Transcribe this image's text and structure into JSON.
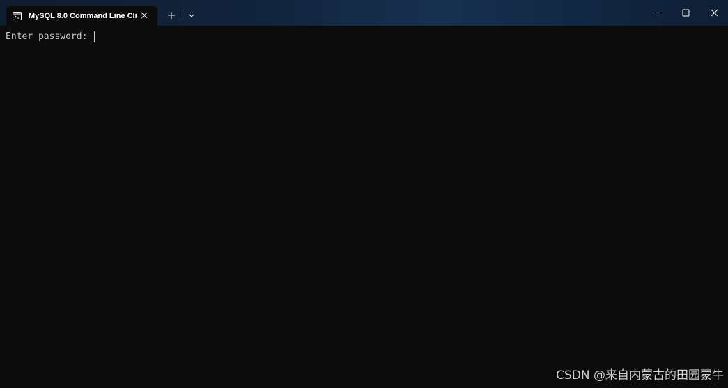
{
  "window": {
    "tab_title": "MySQL 8.0 Command Line Cli",
    "tab_icon": "terminal-icon",
    "new_tab_icon": "plus-icon",
    "dropdown_icon": "chevron-down-icon",
    "minimize_icon": "minimize-icon",
    "maximize_icon": "maximize-icon",
    "close_icon": "close-icon"
  },
  "console": {
    "prompt": "Enter password: "
  },
  "watermark": {
    "text": "CSDN @来自内蒙古的田园蒙牛"
  },
  "colors": {
    "console_bg": "#0c0c0c",
    "console_text": "#cccccc",
    "title_text": "#ffffff"
  }
}
